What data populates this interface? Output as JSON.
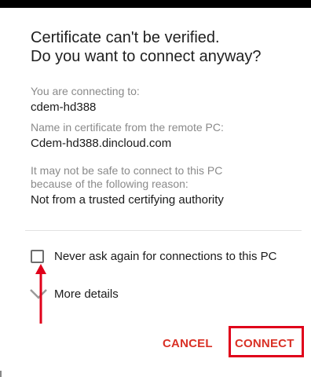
{
  "dialog": {
    "title": "Certificate can't be verified.\nDo you want to connect anyway?",
    "connecting_label": "You are connecting to:",
    "connecting_value": "cdem-hd388",
    "cert_name_label": "Name in certificate from the remote PC:",
    "cert_name_value": "Cdem-hd388.dincloud.com",
    "reason_label": "It may not be safe to connect to this PC\nbecause of the following reason:",
    "reason_value": "Not from a trusted certifying authority",
    "never_ask": {
      "label": "Never ask again for connections to this PC",
      "checked": false
    },
    "more_details_label": "More details",
    "buttons": {
      "cancel": "CANCEL",
      "connect": "CONNECT"
    }
  },
  "icons": {
    "chevron": "chevron-down-icon",
    "annotation": "red-arrow-annotation"
  },
  "colors": {
    "accent": "#d93025",
    "annotation": "#e0001a",
    "label_gray": "#8a8a8a",
    "text": "#1a1a1a"
  }
}
